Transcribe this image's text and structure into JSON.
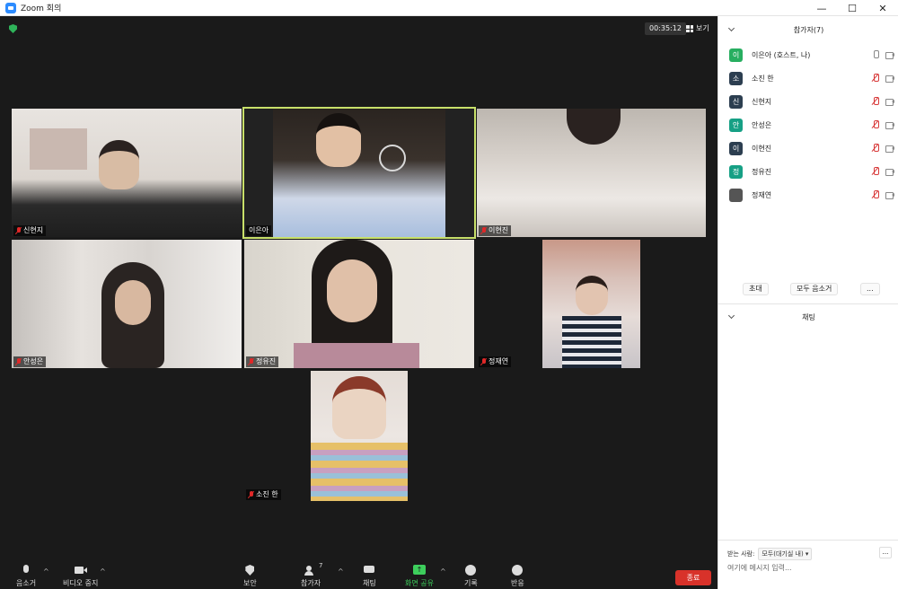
{
  "window": {
    "title": "Zoom 회의",
    "minimize": "—",
    "maximize": "☐",
    "close": "✕"
  },
  "meeting": {
    "timer": "00:35:12",
    "view_label": "보기"
  },
  "tiles": [
    {
      "name": "신현지",
      "muted": true
    },
    {
      "name": "이은아",
      "muted": false
    },
    {
      "name": "이현진",
      "muted": true
    },
    {
      "name": "안성은",
      "muted": true
    },
    {
      "name": "정유진",
      "muted": true
    },
    {
      "name": "정재연",
      "muted": true
    },
    {
      "name": "소진 한",
      "muted": true
    }
  ],
  "toolbar": {
    "mute": "음소거",
    "video": "비디오 중지",
    "security": "보안",
    "participants": "참가자",
    "participants_count": "7",
    "chat": "채팅",
    "share": "화면 공유",
    "record": "기록",
    "reactions": "반응",
    "end": "종료",
    "caret": "^"
  },
  "panel": {
    "participants_title": "참가자(7)",
    "participants": [
      {
        "initial": "이",
        "name": "이은아 (호스트, 나)",
        "color": "#27ae60",
        "mic": "on"
      },
      {
        "initial": "소",
        "name": "소진 한",
        "color": "#2c3e50",
        "mic": "off"
      },
      {
        "initial": "신",
        "name": "신현지",
        "color": "#2c3e50",
        "mic": "off"
      },
      {
        "initial": "안",
        "name": "안성은",
        "color": "#16a085",
        "mic": "off"
      },
      {
        "initial": "이",
        "name": "이현진",
        "color": "#2c3e50",
        "mic": "off"
      },
      {
        "initial": "정",
        "name": "정유진",
        "color": "#16a085",
        "mic": "off"
      },
      {
        "initial": "",
        "name": "정재연",
        "color": "#555555",
        "mic": "off"
      }
    ],
    "invite": "초대",
    "mute_all": "모두 음소거",
    "more": "...",
    "chat_title": "채팅",
    "send_to_label": "받는 사람:",
    "send_to_value": "모두(대기실 내)",
    "chat_placeholder": "여기에 메시지 입력..."
  }
}
